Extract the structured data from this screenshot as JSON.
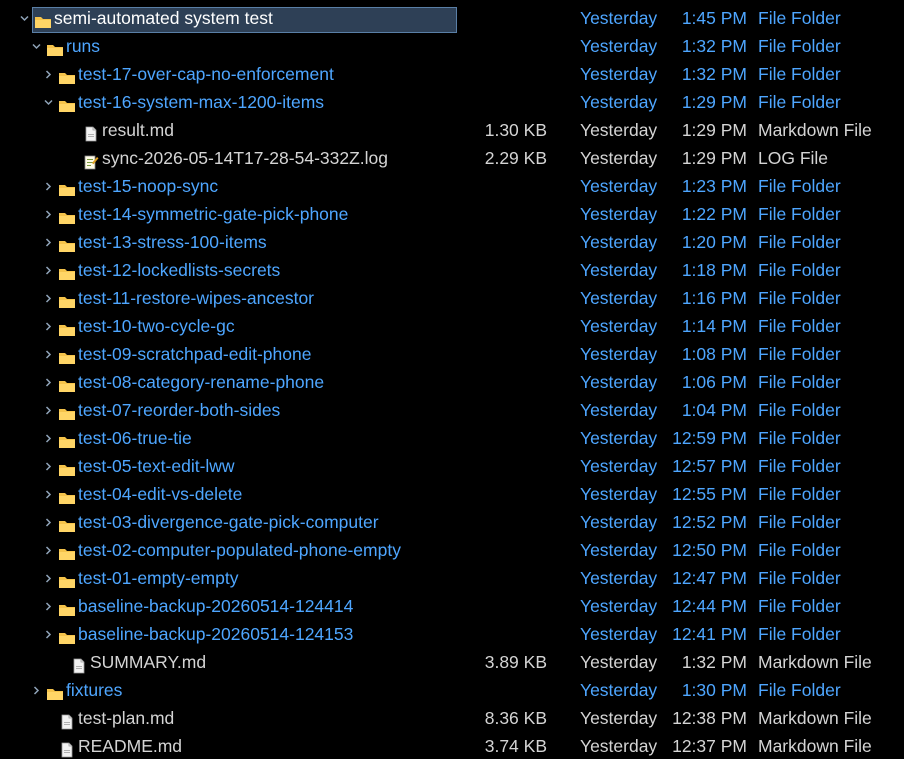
{
  "colors": {
    "background": "#000000",
    "folder_text": "#4ea6ff",
    "file_text": "#d4d4d4",
    "selection_bg": "#2e4056",
    "selection_border": "#5a7fa6",
    "folder_icon": "#f5c34a"
  },
  "tree": {
    "rows": [
      {
        "name": "semi-automated system test",
        "kind": "folder",
        "expanded": true,
        "depth": 0,
        "selected": true,
        "size": "",
        "date": "Yesterday",
        "time": "1:45 PM",
        "type": "File Folder"
      },
      {
        "name": "runs",
        "kind": "folder",
        "expanded": true,
        "depth": 1,
        "size": "",
        "date": "Yesterday",
        "time": "1:32 PM",
        "type": "File Folder"
      },
      {
        "name": "test-17-over-cap-no-enforcement",
        "kind": "folder",
        "expanded": false,
        "depth": 2,
        "size": "",
        "date": "Yesterday",
        "time": "1:32 PM",
        "type": "File Folder"
      },
      {
        "name": "test-16-system-max-1200-items",
        "kind": "folder",
        "expanded": true,
        "depth": 2,
        "size": "",
        "date": "Yesterday",
        "time": "1:29 PM",
        "type": "File Folder"
      },
      {
        "name": "result.md",
        "kind": "file",
        "icon": "markdown-file-icon",
        "depth": 3,
        "size": "1.30 KB",
        "date": "Yesterday",
        "time": "1:29 PM",
        "type": "Markdown File"
      },
      {
        "name": "sync-2026-05-14T17-28-54-332Z.log",
        "kind": "file",
        "icon": "log-file-icon",
        "depth": 3,
        "size": "2.29 KB",
        "date": "Yesterday",
        "time": "1:29 PM",
        "type": "LOG File"
      },
      {
        "name": "test-15-noop-sync",
        "kind": "folder",
        "expanded": false,
        "depth": 2,
        "size": "",
        "date": "Yesterday",
        "time": "1:23 PM",
        "type": "File Folder"
      },
      {
        "name": "test-14-symmetric-gate-pick-phone",
        "kind": "folder",
        "expanded": false,
        "depth": 2,
        "size": "",
        "date": "Yesterday",
        "time": "1:22 PM",
        "type": "File Folder"
      },
      {
        "name": "test-13-stress-100-items",
        "kind": "folder",
        "expanded": false,
        "depth": 2,
        "size": "",
        "date": "Yesterday",
        "time": "1:20 PM",
        "type": "File Folder"
      },
      {
        "name": "test-12-lockedlists-secrets",
        "kind": "folder",
        "expanded": false,
        "depth": 2,
        "size": "",
        "date": "Yesterday",
        "time": "1:18 PM",
        "type": "File Folder"
      },
      {
        "name": "test-11-restore-wipes-ancestor",
        "kind": "folder",
        "expanded": false,
        "depth": 2,
        "size": "",
        "date": "Yesterday",
        "time": "1:16 PM",
        "type": "File Folder"
      },
      {
        "name": "test-10-two-cycle-gc",
        "kind": "folder",
        "expanded": false,
        "depth": 2,
        "size": "",
        "date": "Yesterday",
        "time": "1:14 PM",
        "type": "File Folder"
      },
      {
        "name": "test-09-scratchpad-edit-phone",
        "kind": "folder",
        "expanded": false,
        "depth": 2,
        "size": "",
        "date": "Yesterday",
        "time": "1:08 PM",
        "type": "File Folder"
      },
      {
        "name": "test-08-category-rename-phone",
        "kind": "folder",
        "expanded": false,
        "depth": 2,
        "size": "",
        "date": "Yesterday",
        "time": "1:06 PM",
        "type": "File Folder"
      },
      {
        "name": "test-07-reorder-both-sides",
        "kind": "folder",
        "expanded": false,
        "depth": 2,
        "size": "",
        "date": "Yesterday",
        "time": "1:04 PM",
        "type": "File Folder"
      },
      {
        "name": "test-06-true-tie",
        "kind": "folder",
        "expanded": false,
        "depth": 2,
        "size": "",
        "date": "Yesterday",
        "time": "12:59 PM",
        "type": "File Folder"
      },
      {
        "name": "test-05-text-edit-lww",
        "kind": "folder",
        "expanded": false,
        "depth": 2,
        "size": "",
        "date": "Yesterday",
        "time": "12:57 PM",
        "type": "File Folder"
      },
      {
        "name": "test-04-edit-vs-delete",
        "kind": "folder",
        "expanded": false,
        "depth": 2,
        "size": "",
        "date": "Yesterday",
        "time": "12:55 PM",
        "type": "File Folder"
      },
      {
        "name": "test-03-divergence-gate-pick-computer",
        "kind": "folder",
        "expanded": false,
        "depth": 2,
        "size": "",
        "date": "Yesterday",
        "time": "12:52 PM",
        "type": "File Folder"
      },
      {
        "name": "test-02-computer-populated-phone-empty",
        "kind": "folder",
        "expanded": false,
        "depth": 2,
        "size": "",
        "date": "Yesterday",
        "time": "12:50 PM",
        "type": "File Folder"
      },
      {
        "name": "test-01-empty-empty",
        "kind": "folder",
        "expanded": false,
        "depth": 2,
        "size": "",
        "date": "Yesterday",
        "time": "12:47 PM",
        "type": "File Folder"
      },
      {
        "name": "baseline-backup-20260514-124414",
        "kind": "folder",
        "expanded": false,
        "depth": 2,
        "size": "",
        "date": "Yesterday",
        "time": "12:44 PM",
        "type": "File Folder"
      },
      {
        "name": "baseline-backup-20260514-124153",
        "kind": "folder",
        "expanded": false,
        "depth": 2,
        "size": "",
        "date": "Yesterday",
        "time": "12:41 PM",
        "type": "File Folder"
      },
      {
        "name": "SUMMARY.md",
        "kind": "file",
        "icon": "markdown-file-icon",
        "depth": 2,
        "size": "3.89 KB",
        "date": "Yesterday",
        "time": "1:32 PM",
        "type": "Markdown File"
      },
      {
        "name": "fixtures",
        "kind": "folder",
        "expanded": false,
        "depth": 1,
        "size": "",
        "date": "Yesterday",
        "time": "1:30 PM",
        "type": "File Folder"
      },
      {
        "name": "test-plan.md",
        "kind": "file",
        "icon": "markdown-file-icon",
        "depth": 1,
        "size": "8.36 KB",
        "date": "Yesterday",
        "time": "12:38 PM",
        "type": "Markdown File"
      },
      {
        "name": "README.md",
        "kind": "file",
        "icon": "markdown-file-icon",
        "depth": 1,
        "size": "3.74 KB",
        "date": "Yesterday",
        "time": "12:37 PM",
        "type": "Markdown File"
      }
    ]
  }
}
